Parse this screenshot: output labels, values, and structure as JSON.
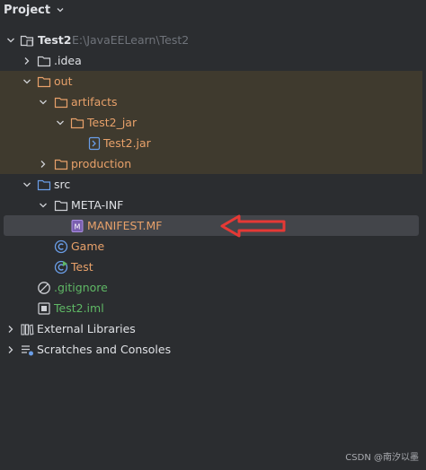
{
  "panel": {
    "title": "Project"
  },
  "tree": {
    "root": {
      "label": "Test2",
      "path": "E:\\JavaEELearn\\Test2"
    },
    "idea": {
      "label": ".idea"
    },
    "out": {
      "label": "out"
    },
    "artifacts": {
      "label": "artifacts"
    },
    "test2_jar_dir": {
      "label": "Test2_jar"
    },
    "test2_jar_file": {
      "label": "Test2.jar"
    },
    "production": {
      "label": "production"
    },
    "src": {
      "label": "src"
    },
    "meta_inf": {
      "label": "META-INF"
    },
    "manifest": {
      "label": "MANIFEST.MF"
    },
    "game": {
      "label": "Game"
    },
    "test": {
      "label": "Test"
    },
    "gitignore": {
      "label": ".gitignore"
    },
    "iml": {
      "label": "Test2.iml"
    },
    "external_libraries": {
      "label": "External Libraries"
    },
    "scratches": {
      "label": "Scratches and Consoles"
    }
  },
  "watermark": "CSDN @南汐以墨",
  "colors": {
    "background": "#2b2d30",
    "excluded_row": "#3f3a2e",
    "selected_row": "#43454a",
    "annotation_arrow": "#e53935",
    "excluded_text": "#e8a16a",
    "vcs_new_text": "#5fb865"
  }
}
